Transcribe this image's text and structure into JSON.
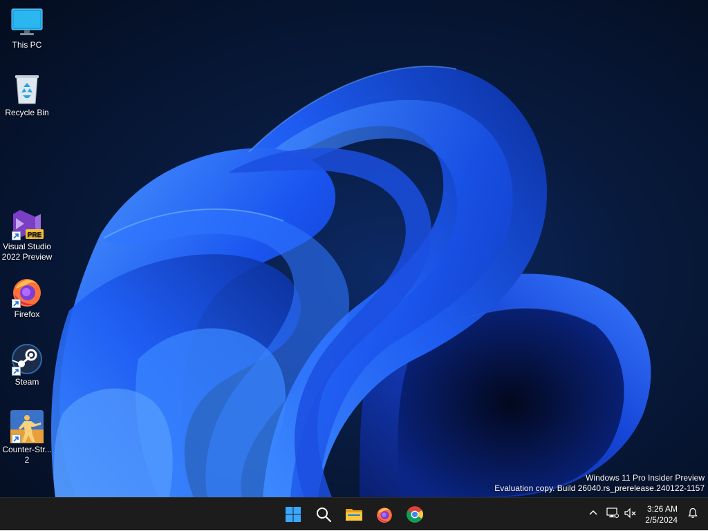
{
  "desktop": {
    "icons": [
      {
        "label": "This PC",
        "icon": "monitor-icon"
      },
      {
        "label": "Recycle Bin",
        "icon": "recycle-bin-icon"
      },
      {
        "label": "Visual Studio 2022 Preview",
        "icon": "visual-studio-icon",
        "badge": "PRE"
      },
      {
        "label": "Firefox",
        "icon": "firefox-icon"
      },
      {
        "label": "Steam",
        "icon": "steam-icon"
      },
      {
        "label": "Counter-Str... 2",
        "icon": "counter-strike-icon"
      }
    ],
    "watermark": {
      "line1": "Windows 11 Pro Insider Preview",
      "line2": "Evaluation copy. Build 26040.rs_prerelease.240122-1157"
    }
  },
  "taskbar": {
    "pinned": [
      {
        "name": "Start",
        "icon": "windows-logo-icon"
      },
      {
        "name": "Search",
        "icon": "search-icon"
      },
      {
        "name": "File Explorer",
        "icon": "folder-icon"
      },
      {
        "name": "Firefox",
        "icon": "firefox-icon"
      },
      {
        "name": "Chrome",
        "icon": "chrome-icon"
      }
    ],
    "tray": {
      "icons": [
        "chevron-up-icon",
        "network-icon",
        "volume-muted-icon",
        "bell-icon"
      ],
      "time": "3:26 AM",
      "date": "2/5/2024"
    }
  },
  "colors": {
    "accent": "#0a64ff",
    "taskbar_bg": "#1c1c1c",
    "desktop_bg": "#081a3d"
  }
}
